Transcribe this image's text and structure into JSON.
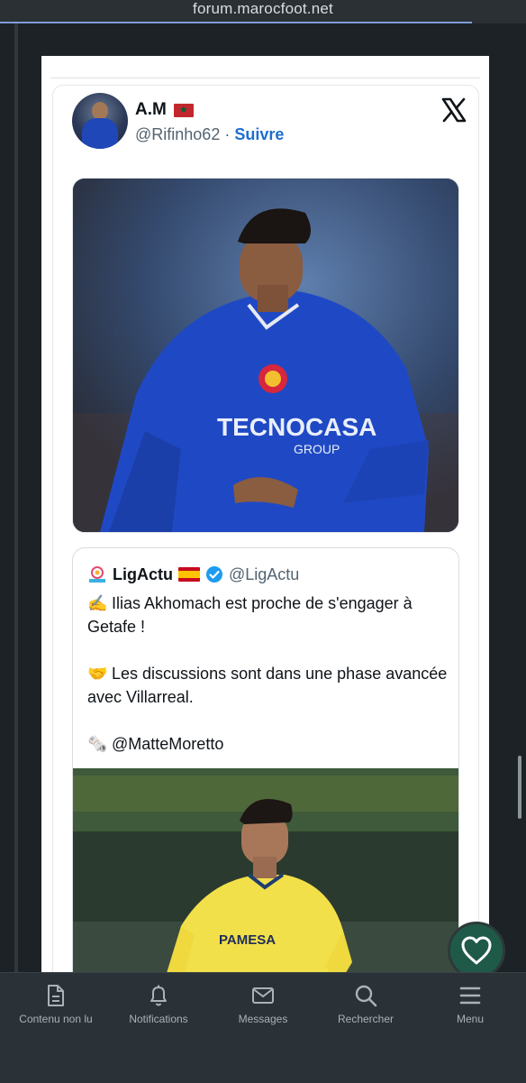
{
  "browser": {
    "url": "forum.marocfoot.net"
  },
  "tweet": {
    "author_name": "A.M",
    "author_handle": "@Rifinho62",
    "separator": "·",
    "follow_label": "Suivre",
    "author_flag_icon": "morocco-flag-icon",
    "platform_icon": "x-logo-icon"
  },
  "quoted": {
    "name": "LigActu",
    "handle": "@LigActu",
    "flag_icon": "spain-flag-icon",
    "verified_icon": "verified-badge-icon",
    "lines": [
      {
        "emoji": "✍️",
        "text": "Ilias Akhomach est proche de s'engager à Getafe !"
      },
      {
        "emoji": "🤝",
        "text": "Les discussions sont dans une phase avancée avec Villarreal."
      },
      {
        "emoji": "🗞️",
        "text": "@MatteMoretto"
      }
    ]
  },
  "bottom_nav": {
    "items": [
      {
        "label": "Contenu non lu",
        "icon": "document-icon"
      },
      {
        "label": "Notifications",
        "icon": "bell-icon"
      },
      {
        "label": "Messages",
        "icon": "envelope-icon"
      },
      {
        "label": "Rechercher",
        "icon": "search-icon"
      },
      {
        "label": "Menu",
        "icon": "hamburger-icon"
      }
    ]
  },
  "fab": {
    "icon": "heart-icon"
  },
  "colors": {
    "accent_link": "#1d6fd1",
    "nav_background": "#2b3237",
    "fab_background": "#1f5a48"
  }
}
